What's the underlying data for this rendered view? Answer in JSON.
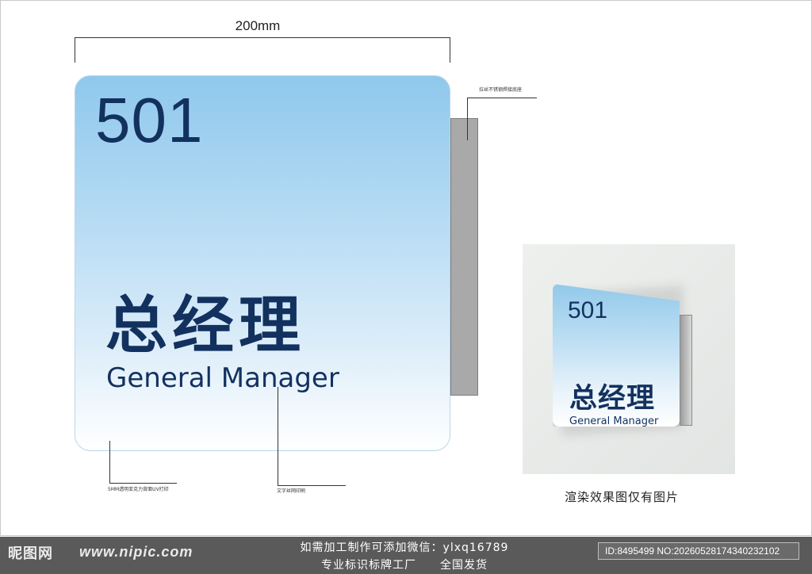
{
  "dimension": {
    "width_label": "200mm"
  },
  "sign": {
    "room_number": "501",
    "title_cn": "总经理",
    "title_en": "General Manager"
  },
  "notes": {
    "base_note": "拉丝不锈钢焊接底座",
    "acrylic_note": "5MM透明亚克力背面UV打印",
    "text_note": "文字丝网印刷"
  },
  "preview": {
    "room_number": "501",
    "title_cn": "总经理",
    "title_en": "General Manager",
    "caption": "渲染效果图仅有图片"
  },
  "footer": {
    "logo": "昵图网",
    "website": "www.nipic.com",
    "contact_line1": "如需加工制作可添加微信：ylxq16789",
    "contact_line2": "专业标识标牌工厂　　全国发货",
    "id_text": "ID:8495499 NO:20260528174340232102"
  },
  "colors": {
    "text_navy": "#13315f",
    "sign_top_blue": "#8fc8ec"
  }
}
